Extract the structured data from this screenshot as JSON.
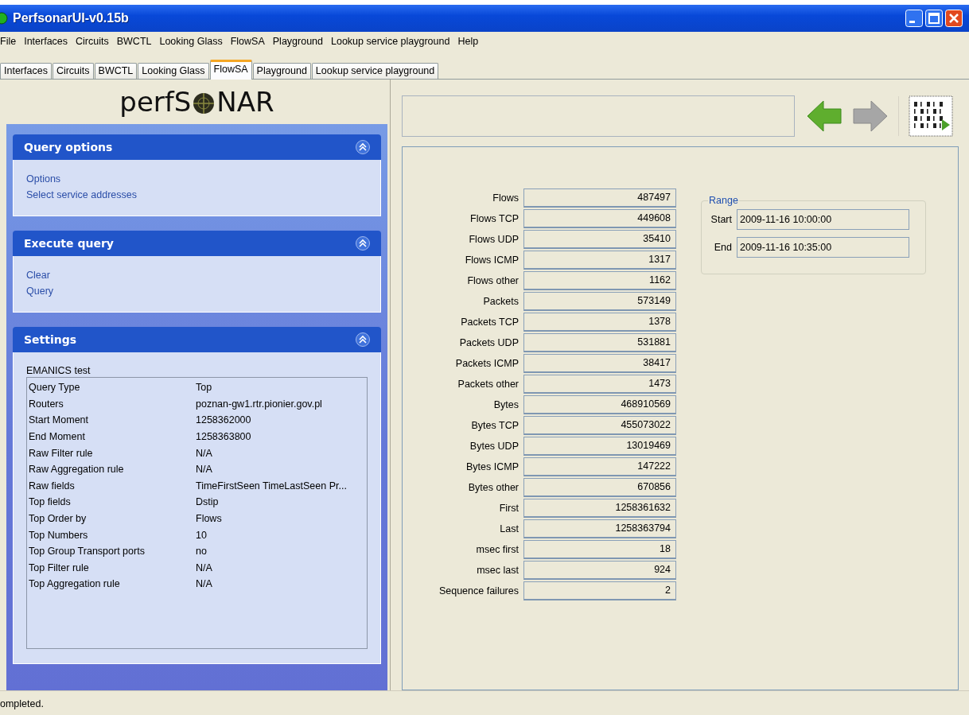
{
  "window": {
    "title": "PerfsonarUI-v0.15b"
  },
  "menu": [
    "File",
    "Interfaces",
    "Circuits",
    "BWCTL",
    "Looking Glass",
    "FlowSA",
    "Playground",
    "Lookup service playground",
    "Help"
  ],
  "tabs": [
    {
      "label": "Interfaces",
      "selected": false
    },
    {
      "label": "Circuits",
      "selected": false
    },
    {
      "label": "BWCTL",
      "selected": false
    },
    {
      "label": "Looking Glass",
      "selected": false
    },
    {
      "label": "FlowSA",
      "selected": true
    },
    {
      "label": "Playground",
      "selected": false
    },
    {
      "label": "Lookup service playground",
      "selected": false
    }
  ],
  "sidebar": {
    "logo": [
      "perfS",
      "NAR"
    ],
    "sections": [
      {
        "kind": "links",
        "title": "Query options",
        "expanded": true,
        "items": [
          "Options",
          "Select service addresses"
        ]
      },
      {
        "kind": "links",
        "title": "Execute query",
        "expanded": true,
        "items": [
          "Clear",
          "Query"
        ]
      },
      {
        "kind": "properties",
        "title": "Settings",
        "expanded": true,
        "caption": "EMANICS test",
        "rows": [
          {
            "name": "Query Type",
            "value": "Top"
          },
          {
            "name": "Routers",
            "value": "poznan-gw1.rtr.pionier.gov.pl"
          },
          {
            "name": "Start Moment",
            "value": "1258362000"
          },
          {
            "name": "End Moment",
            "value": "1258363800"
          },
          {
            "name": "Raw Filter rule",
            "value": "N/A"
          },
          {
            "name": "Raw Aggregation rule",
            "value": "N/A"
          },
          {
            "name": "Raw fields",
            "value": "TimeFirstSeen TimeLastSeen Pr..."
          },
          {
            "name": "Top fields",
            "value": "Dstip"
          },
          {
            "name": "Top Order by",
            "value": "Flows"
          },
          {
            "name": "Top Numbers",
            "value": "10"
          },
          {
            "name": "Top Group Transport ports",
            "value": "no"
          },
          {
            "name": "Top Filter rule",
            "value": "N/A"
          },
          {
            "name": "Top Aggregation rule",
            "value": "N/A"
          }
        ]
      }
    ]
  },
  "stats": [
    {
      "label": "Flows",
      "value": "487497"
    },
    {
      "label": "Flows TCP",
      "value": "449608"
    },
    {
      "label": "Flows UDP",
      "value": "35410"
    },
    {
      "label": "Flows ICMP",
      "value": "1317"
    },
    {
      "label": "Flows other",
      "value": "1162"
    },
    {
      "label": "Packets",
      "value": "573149"
    },
    {
      "label": "Packets TCP",
      "value": "1378"
    },
    {
      "label": "Packets UDP",
      "value": "531881"
    },
    {
      "label": "Packets ICMP",
      "value": "38417"
    },
    {
      "label": "Packets other",
      "value": "1473"
    },
    {
      "label": "Bytes",
      "value": "468910569"
    },
    {
      "label": "Bytes TCP",
      "value": "455073022"
    },
    {
      "label": "Bytes UDP",
      "value": "13019469"
    },
    {
      "label": "Bytes ICMP",
      "value": "147222"
    },
    {
      "label": "Bytes other",
      "value": "670856"
    },
    {
      "label": "First",
      "value": "1258361632"
    },
    {
      "label": "Last",
      "value": "1258363794"
    },
    {
      "label": "msec first",
      "value": "18"
    },
    {
      "label": "msec last",
      "value": "924"
    },
    {
      "label": "Sequence failures",
      "value": "2"
    }
  ],
  "range": {
    "title": "Range",
    "fields": [
      {
        "label": "Start",
        "value": "2009-11-16 10:00:00"
      },
      {
        "label": "End",
        "value": "2009-11-16 10:35:00"
      }
    ]
  },
  "status_bar": "ompleted."
}
